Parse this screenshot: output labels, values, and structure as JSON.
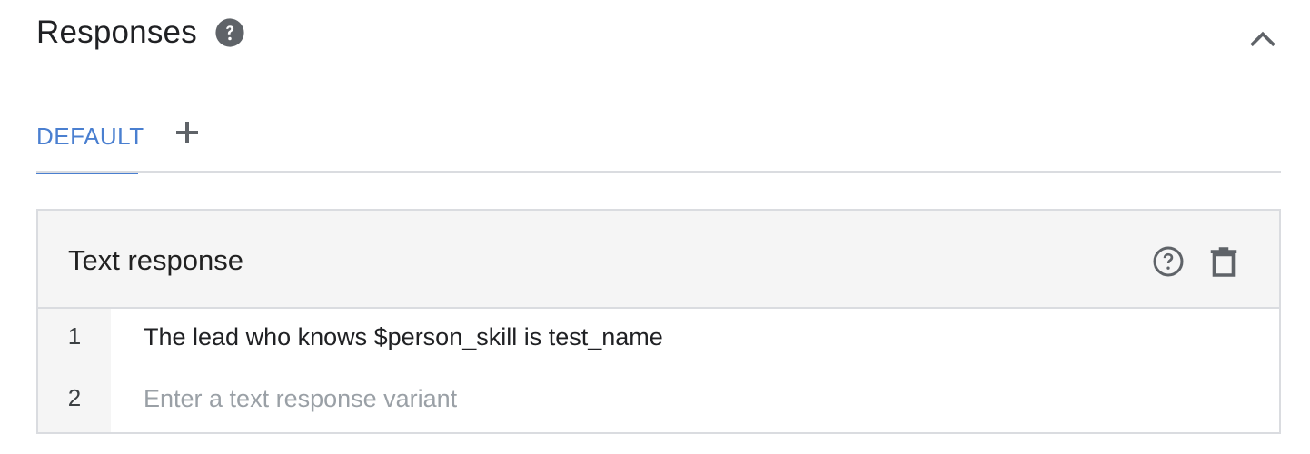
{
  "section": {
    "title": "Responses",
    "help_icon": "help-circle-filled-icon",
    "collapse_icon": "chevron-up-icon"
  },
  "tabs": {
    "items": [
      {
        "label": "DEFAULT",
        "active": true
      }
    ],
    "add_icon": "plus-icon"
  },
  "card": {
    "title": "Text response",
    "help_icon": "help-circle-outline-icon",
    "delete_icon": "trash-icon",
    "rows": [
      {
        "number": "1",
        "value": "The lead who knows $person_skill is test_name",
        "placeholder": ""
      },
      {
        "number": "2",
        "value": "",
        "placeholder": "Enter a text response variant"
      }
    ]
  },
  "colors": {
    "accent": "#4a7fd0",
    "header_bg": "#f5f5f5",
    "border": "#dadce0",
    "icon": "#5f6368",
    "placeholder": "#9aa0a6"
  }
}
